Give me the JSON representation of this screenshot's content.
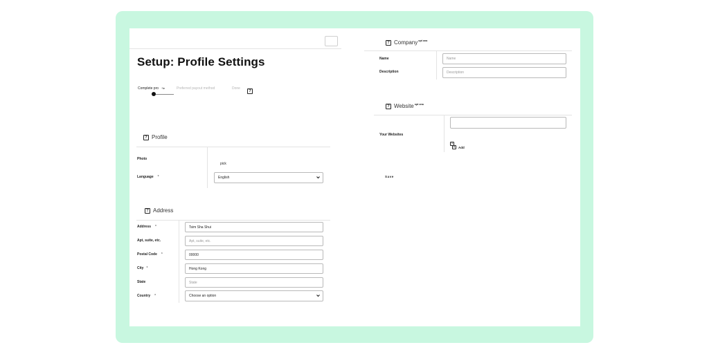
{
  "page_title": "Setup: Profile Settings",
  "steps": {
    "step1": "Complete pro",
    "step1_mark": "*le",
    "step2": "Preferred payout method",
    "step3": "Done"
  },
  "profile": {
    "heading": "Profile",
    "photo_label": "Photo",
    "photo_action": "pick",
    "language_label": "Language",
    "language_req": "*",
    "language_value": "English"
  },
  "address": {
    "heading": "Address",
    "address_label": "Address",
    "address_req": "*",
    "address_value": "Tsim Sha Shui",
    "apt_label": "Apt, suite, etc.",
    "apt_placeholder": "Apt, suite, etc.",
    "postal_label": "Postal Code",
    "postal_req": "*",
    "postal_value": "00000",
    "city_label": "City",
    "city_req": "*",
    "city_value": "Hong Kong",
    "state_label": "State",
    "state_placeholder": "State",
    "country_label": "Country",
    "country_req": "*",
    "country_value": "Choose an option"
  },
  "company": {
    "heading": "Company",
    "heading_note": "opt ona",
    "name_label": "Name",
    "name_placeholder": "Name",
    "description_label": "Description",
    "description_placeholder": "Description"
  },
  "website": {
    "heading": "Website",
    "heading_note": "opt ona",
    "label": "Your Websites",
    "add_label": "Add"
  },
  "save_label": "Save",
  "icons": {
    "help": "question-mark-box",
    "select": "chevron-down",
    "add": "plus-box"
  },
  "colors": {
    "frame": "#c8f7e0",
    "card": "#ffffff",
    "border": "#b9b9b9",
    "text": "#222222"
  }
}
